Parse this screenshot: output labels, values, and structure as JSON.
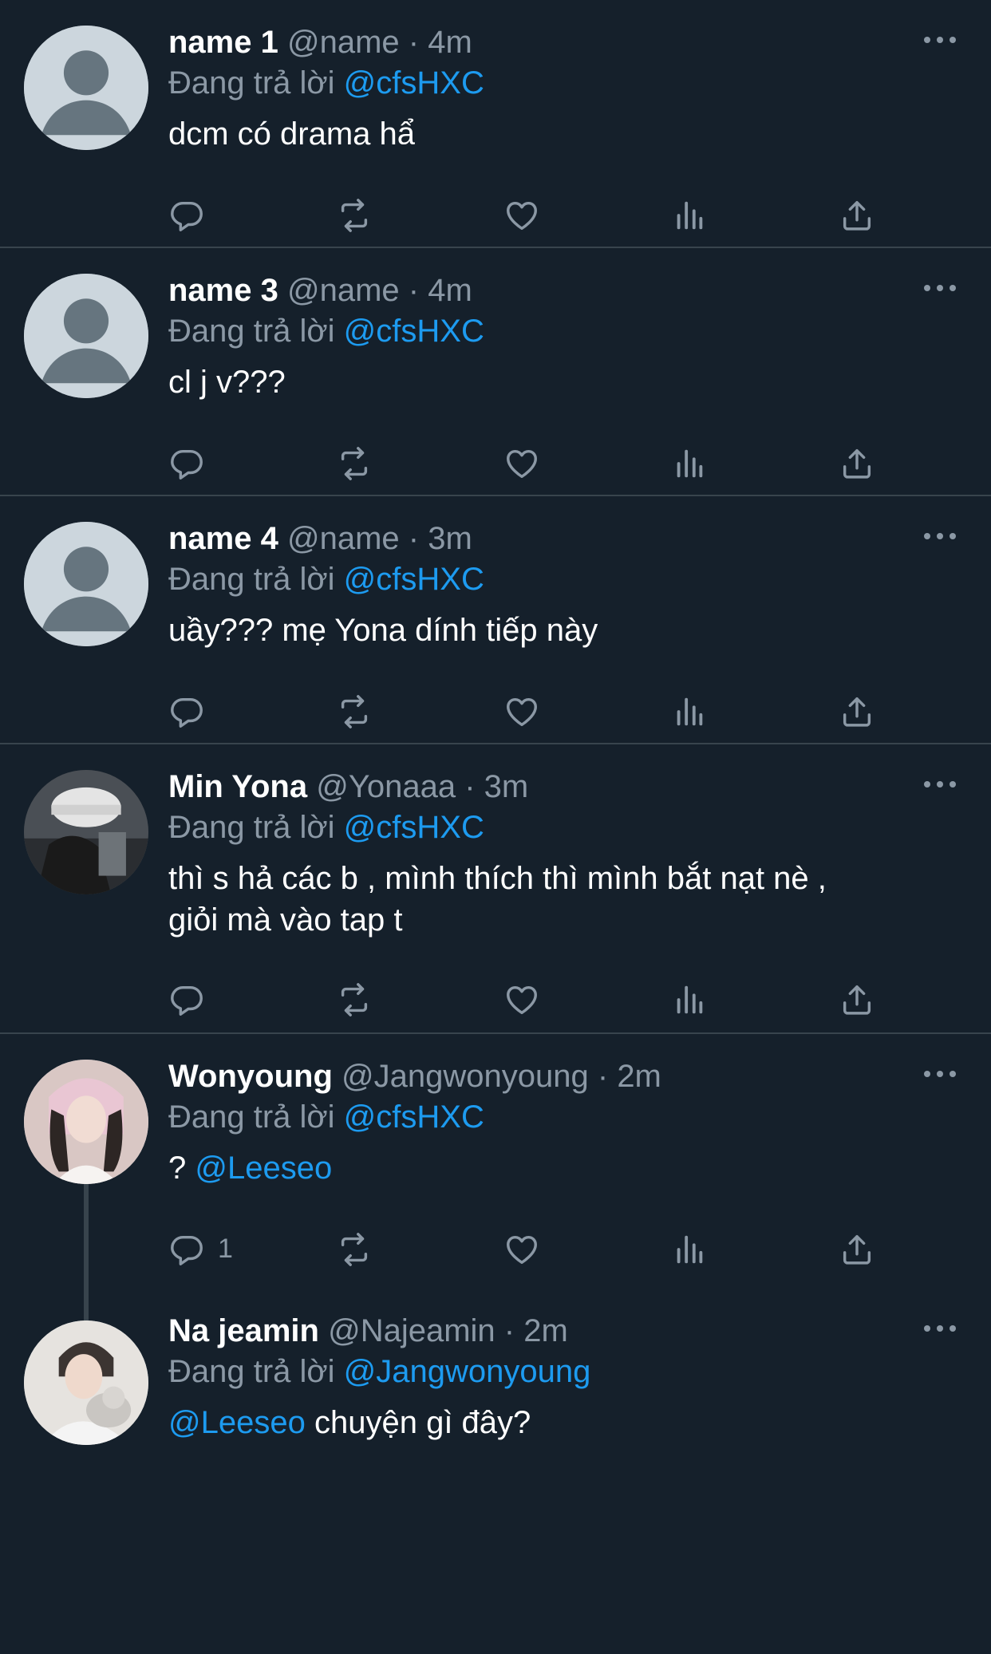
{
  "reply_prefix": "Đang trả lời",
  "tweets": [
    {
      "name": "name 1",
      "handle": "@name",
      "time": "4m",
      "reply_to": "@cfsHXC",
      "text": "dcm có drama hẩ",
      "reply_count": ""
    },
    {
      "name": "name 3",
      "handle": "@name",
      "time": "4m",
      "reply_to": "@cfsHXC",
      "text": "cl j v???",
      "reply_count": ""
    },
    {
      "name": "name 4",
      "handle": "@name",
      "time": "3m",
      "reply_to": "@cfsHXC",
      "text": "uầy??? mẹ Yona dính tiếp này",
      "reply_count": ""
    },
    {
      "name": "Min Yona",
      "handle": "@Yonaaa",
      "time": "3m",
      "reply_to": "@cfsHXC",
      "text_line1": "thì s hả các b , mình thích thì mình bắt nạt nè ,",
      "text_line2": "giỏi mà vào tap t",
      "reply_count": ""
    },
    {
      "name": "Wonyoung",
      "handle": "@Jangwonyoung",
      "time": "2m",
      "reply_to": "@cfsHXC",
      "text_prefix": "?",
      "text_mention": "@Leeseo",
      "reply_count": "1"
    },
    {
      "name": "Na jeamin",
      "handle": "@Najeamin",
      "time": "2m",
      "reply_to": "@Jangwonyoung",
      "text_mention": "@Leeseo",
      "text_rest": "chuyện gì đây?"
    }
  ],
  "separator": "·",
  "icons": [
    "reply-icon",
    "retweet-icon",
    "like-icon",
    "views-icon",
    "share-icon",
    "more-icon"
  ],
  "colors": {
    "background": "#15202b",
    "accent": "#1d9bf0",
    "muted": "#8b98a5",
    "divider": "#38444d"
  }
}
